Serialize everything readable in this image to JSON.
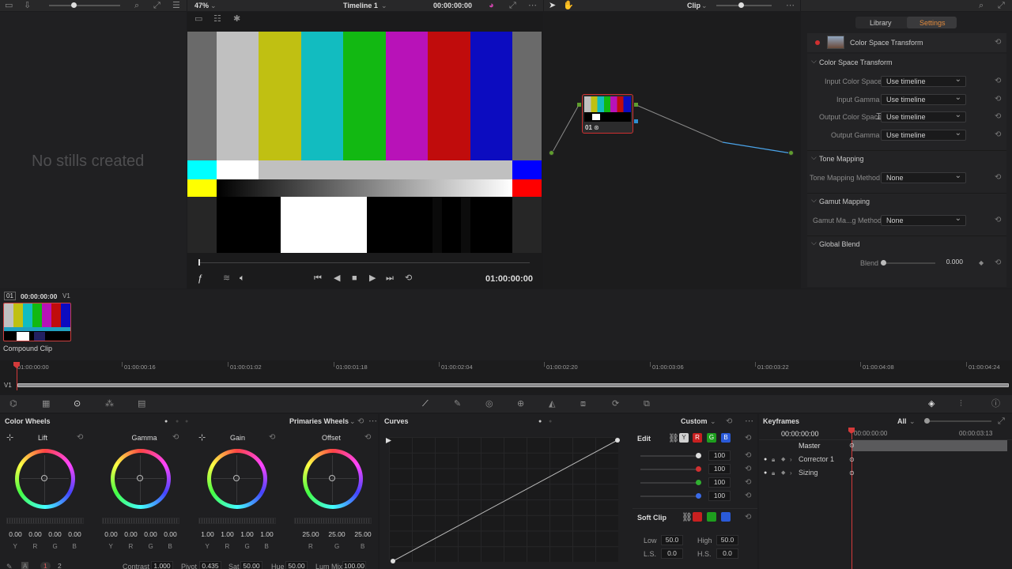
{
  "viewer": {
    "zoom": "47%",
    "timeline_name": "Timeline 1",
    "timecode_top": "00:00:00:00",
    "timecode_bottom": "01:00:00:00"
  },
  "gallery": {
    "empty_text": "No stills created"
  },
  "node_editor": {
    "mode": "Clip",
    "node_label": "01"
  },
  "inspector": {
    "tabs": [
      "Library",
      "Settings"
    ],
    "fx_title": "Color Space Transform",
    "sections": {
      "cst": "Color Space Transform",
      "tone": "Tone Mapping",
      "gamut": "Gamut Mapping",
      "blend": "Global Blend"
    },
    "rows": {
      "input_cs": {
        "label": "Input Color Space",
        "value": "Use timeline"
      },
      "input_gamma": {
        "label": "Input Gamma",
        "value": "Use timeline"
      },
      "output_cs": {
        "label": "Output Color Space",
        "value": "Use timeline"
      },
      "output_gamma": {
        "label": "Output Gamma",
        "value": "Use timeline"
      },
      "tone_method": {
        "label": "Tone Mapping Method",
        "value": "None"
      },
      "gamut_method": {
        "label": "Gamut Ma...g Method",
        "value": "None"
      },
      "blend": {
        "label": "Blend",
        "value": "0.000"
      }
    }
  },
  "clips": {
    "index": "01",
    "timecode": "00:00:00:00",
    "track": "V1",
    "clip_name": "Compound Clip"
  },
  "mini_timeline": {
    "track": "V1",
    "ticks": [
      "01:00:00:00",
      "01:00:00:16",
      "01:00:01:02",
      "01:00:01:18",
      "01:00:02:04",
      "01:00:02:20",
      "01:00:03:06",
      "01:00:03:22",
      "01:00:04:08",
      "01:00:04:24"
    ]
  },
  "color_wheels": {
    "title": "Color Wheels",
    "mode": "Primaries Wheels",
    "wheels": [
      {
        "name": "Lift",
        "values": [
          "0.00",
          "0.00",
          "0.00",
          "0.00"
        ],
        "channels": [
          "Y",
          "R",
          "G",
          "B"
        ]
      },
      {
        "name": "Gamma",
        "values": [
          "0.00",
          "0.00",
          "0.00",
          "0.00"
        ],
        "channels": [
          "Y",
          "R",
          "G",
          "B"
        ]
      },
      {
        "name": "Gain",
        "values": [
          "1.00",
          "1.00",
          "1.00",
          "1.00"
        ],
        "channels": [
          "Y",
          "R",
          "G",
          "B"
        ]
      },
      {
        "name": "Offset",
        "values": [
          "25.00",
          "25.00",
          "25.00"
        ],
        "channels": [
          "R",
          "G",
          "B"
        ]
      }
    ],
    "footer": {
      "page1": "1",
      "page2": "2",
      "contrast_label": "Contrast",
      "contrast": "1.000",
      "pivot_label": "Pivot",
      "pivot": "0.435",
      "sat_label": "Sat",
      "sat": "50.00",
      "hue_label": "Hue",
      "hue": "50.00",
      "lummix_label": "Lum Mix",
      "lummix": "100.00"
    }
  },
  "curves": {
    "title": "Curves",
    "mode": "Custom",
    "edit_label": "Edit",
    "channel_chips": [
      "Y",
      "R",
      "G",
      "B"
    ],
    "edit_values": [
      "100",
      "100",
      "100",
      "100"
    ],
    "soft_clip_label": "Soft Clip",
    "low_label": "Low",
    "low": "50.0",
    "high_label": "High",
    "high": "50.0",
    "ls_label": "L.S.",
    "ls": "0.0",
    "hs_label": "H.S.",
    "hs": "0.0"
  },
  "keyframes": {
    "title": "Keyframes",
    "filter": "All",
    "timecode": "00:00:00:00",
    "tc_start": "00:00:00:00",
    "tc_end": "00:00:03:13",
    "tracks": [
      "Master",
      "Corrector 1",
      "Sizing"
    ]
  }
}
